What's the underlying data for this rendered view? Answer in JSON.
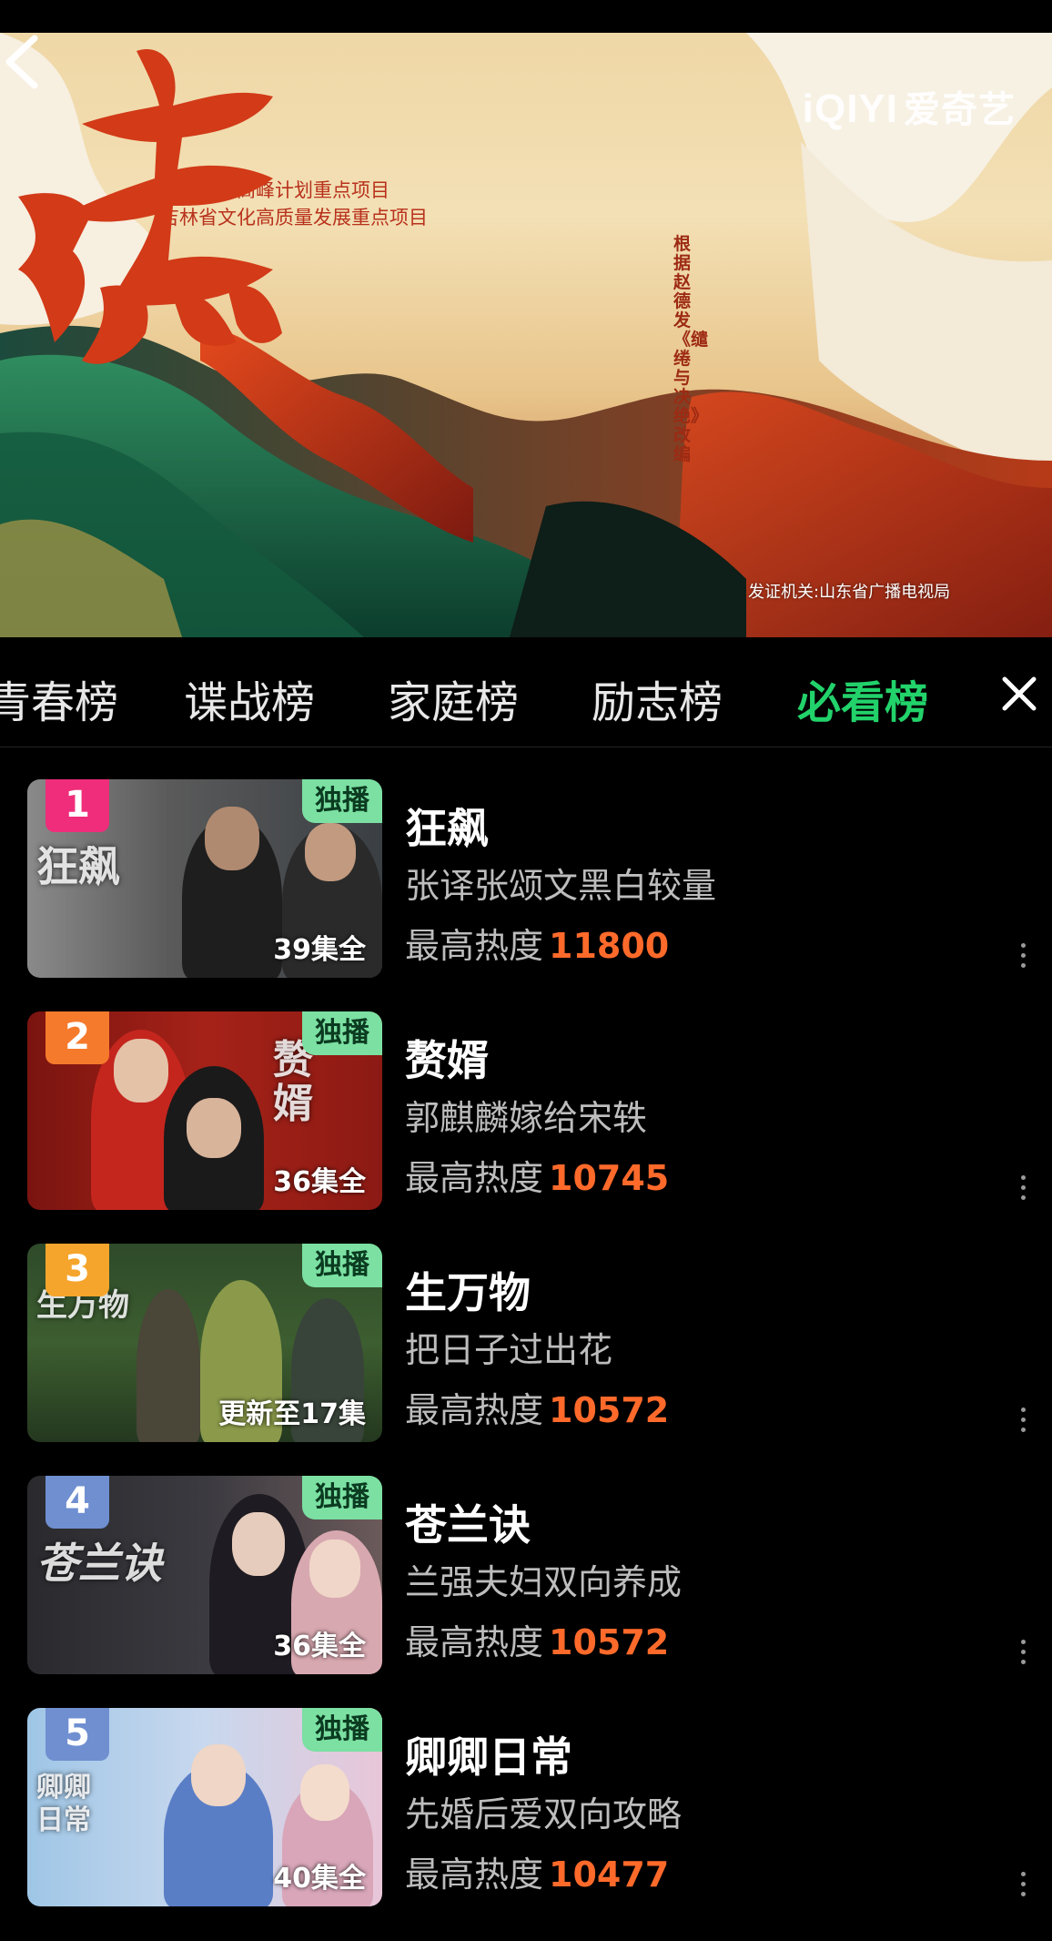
{
  "banner": {
    "brand_logo": "iQIYI",
    "brand_cn": "爱奇艺",
    "promo_line1": "齐鲁文艺高峰计划重点项目",
    "promo_line2": "吉林省文化高质量发展重点项目",
    "title_calligraphy": "生万物",
    "credit_vertical": "根据赵德发《缱绻与决绝》改编",
    "license": "发证机关:山东省广播电视局"
  },
  "tabs": [
    {
      "label": "青春榜"
    },
    {
      "label": "谍战榜"
    },
    {
      "label": "家庭榜"
    },
    {
      "label": "励志榜"
    },
    {
      "label": "必看榜",
      "active": true
    }
  ],
  "list": [
    {
      "rank": "1",
      "badge": "独播",
      "episodes": "39集全",
      "thumb_title": "狂飙",
      "title": "狂飙",
      "subtitle": "张译张颂文黑白较量",
      "heat_label": "最高热度",
      "heat": "11800",
      "rank_color": "#ef2d7a"
    },
    {
      "rank": "2",
      "badge": "独播",
      "episodes": "36集全",
      "thumb_title": "赘婿",
      "title": "赘婿",
      "subtitle": "郭麒麟嫁给宋轶",
      "heat_label": "最高热度",
      "heat": "10745",
      "rank_color": "#f57a2c"
    },
    {
      "rank": "3",
      "badge": "独播",
      "episodes": "更新至17集",
      "thumb_title": "生万物",
      "title": "生万物",
      "subtitle": "把日子过出花",
      "heat_label": "最高热度",
      "heat": "10572",
      "rank_color": "#f5a52c"
    },
    {
      "rank": "4",
      "badge": "独播",
      "episodes": "36集全",
      "thumb_title": "苍兰诀",
      "title": "苍兰诀",
      "subtitle": "兰强夫妇双向养成",
      "heat_label": "最高热度",
      "heat": "10572",
      "rank_color": "#6f8fd0"
    },
    {
      "rank": "5",
      "badge": "独播",
      "episodes": "40集全",
      "thumb_title": "卿卿日常",
      "title": "卿卿日常",
      "subtitle": "先婚后爱双向攻略",
      "heat_label": "最高热度",
      "heat": "10477",
      "rank_color": "#6f8fd0"
    }
  ],
  "colors": {
    "accent_green": "#22d26a",
    "heat_orange": "#ff6a2b",
    "exclusive_green": "#7be0a2"
  },
  "icons": {
    "back": "chevron-left-icon",
    "close": "close-icon",
    "more": "more-vertical-icon"
  }
}
